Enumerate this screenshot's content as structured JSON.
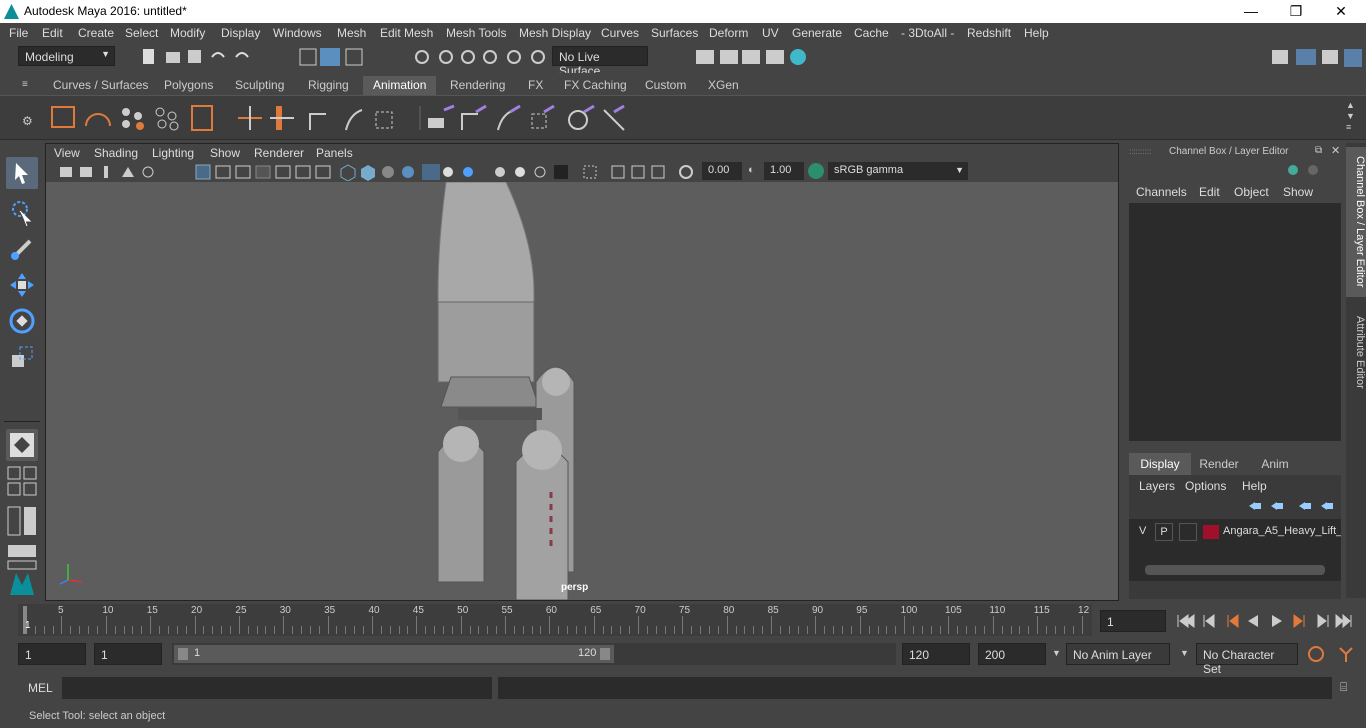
{
  "window": {
    "title": "Autodesk Maya 2016: untitled*",
    "minimize": "—",
    "maximize": "❐",
    "close": "✕"
  },
  "menubar": [
    "File",
    "Edit",
    "Create",
    "Select",
    "Modify",
    "Display",
    "Windows",
    "Mesh",
    "Edit Mesh",
    "Mesh Tools",
    "Mesh Display",
    "Curves",
    "Surfaces",
    "Deform",
    "UV",
    "Generate",
    "Cache",
    "- 3DtoAll -",
    "Redshift",
    "Help"
  ],
  "status_line": {
    "mode": "Modeling",
    "live_surface": "No Live Surface"
  },
  "shelf_tabs": [
    "Curves / Surfaces",
    "Polygons",
    "Sculpting",
    "Rigging",
    "Animation",
    "Rendering",
    "FX",
    "FX Caching",
    "Custom",
    "XGen"
  ],
  "shelf_active": "Animation",
  "viewport": {
    "menu": [
      "View",
      "Shading",
      "Lighting",
      "Show",
      "Renderer",
      "Panels"
    ],
    "exposure": "0.00",
    "gamma": "1.00",
    "color_space": "sRGB gamma",
    "camera_label": "persp"
  },
  "channel_box": {
    "title": "Channel Box / Layer Editor",
    "menu": [
      "Channels",
      "Edit",
      "Object",
      "Show"
    ],
    "layer_tabs": [
      "Display",
      "Render",
      "Anim"
    ],
    "layer_active": "Display",
    "layer_menu": [
      "Layers",
      "Options",
      "Help"
    ],
    "layer": {
      "v": "V",
      "p": "P",
      "name": "Angara_A5_Heavy_Lift_",
      "color": "#a0102a"
    }
  },
  "side_tabs": [
    "Channel Box / Layer Editor",
    "Attribute Editor"
  ],
  "timeline": {
    "ticks": [
      "5",
      "10",
      "15",
      "20",
      "25",
      "30",
      "35",
      "40",
      "45",
      "50",
      "55",
      "60",
      "65",
      "70",
      "75",
      "80",
      "85",
      "90",
      "95",
      "100",
      "105",
      "110",
      "115",
      "12"
    ],
    "current_frame_marker": "1",
    "current_frame": "1"
  },
  "range": {
    "start": "1",
    "anim_start": "1",
    "slider_start": "1",
    "slider_end": "120",
    "anim_end": "120",
    "end": "200",
    "anim_layer": "No Anim Layer",
    "character_set": "No Character Set"
  },
  "command_line": {
    "label": "MEL"
  },
  "help_line": "Select Tool: select an object",
  "colors": {
    "accent": "#5a5a5a",
    "viewport_bg": "#5d5d5d",
    "field_bg": "#2b2b2b"
  }
}
